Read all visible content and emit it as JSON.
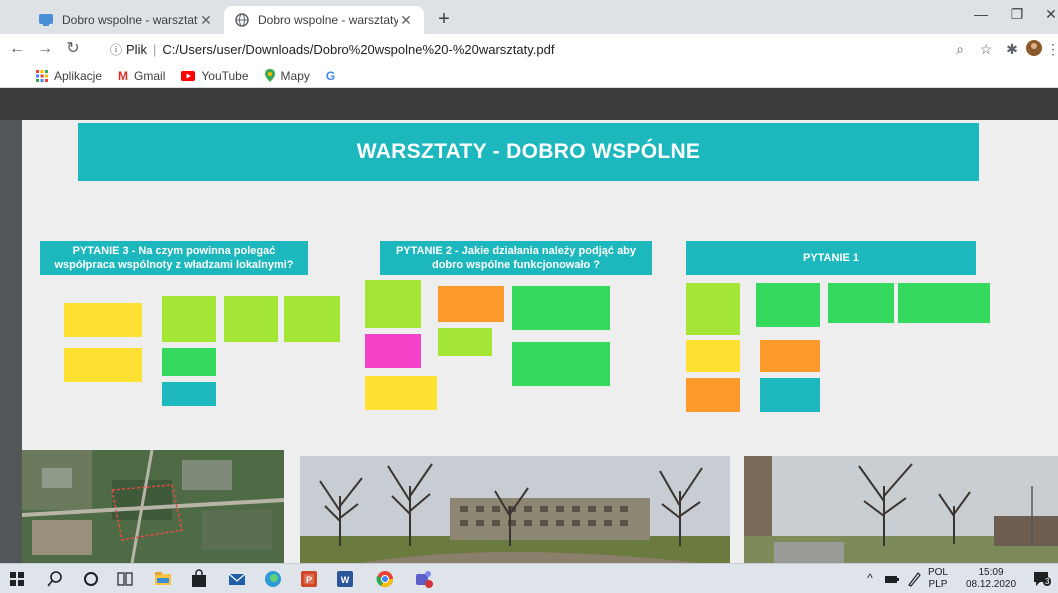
{
  "browser": {
    "tabs": [
      {
        "title": "Dobro wspolne - warsztaty – Coggle",
        "active": false
      },
      {
        "title": "Dobro wspolne - warsztaty",
        "active": true
      }
    ],
    "address_prefix": "Plik",
    "address_url": "C:/Users/user/Downloads/Dobro%20wspolne%20-%20warsztaty.pdf",
    "bookmarks": [
      {
        "label": "Aplikacje",
        "icon": "apps-grid-icon"
      },
      {
        "label": "Gmail",
        "icon": "gmail-icon"
      },
      {
        "label": "YouTube",
        "icon": "youtube-icon"
      },
      {
        "label": "Mapy",
        "icon": "maps-pin-icon"
      },
      {
        "label": "",
        "icon": "google-icon"
      }
    ]
  },
  "document": {
    "banner": "WARSZTATY - DOBRO WSPÓLNE",
    "questions": [
      {
        "title": "PYTANIE 3 - Na czym powinna polegać współpraca wspólnoty z władzami lokalnymi?"
      },
      {
        "title": "PYTANIE 2 - Jakie działania należy podjąć aby dobro wspólne funkcjonowało ?"
      },
      {
        "title": "PYTANIE 1"
      }
    ]
  },
  "taskbar": {
    "lang": "POL",
    "layout": "PLP",
    "time": "15:09",
    "date": "08.12.2020",
    "notifications": "3"
  },
  "colors": {
    "accent_teal": "#1db8be",
    "note_yellow": "#ffe033",
    "note_lime": "#a3e635",
    "note_green": "#34d95e",
    "note_orange": "#fb9a2a",
    "note_magenta": "#f542c8"
  }
}
